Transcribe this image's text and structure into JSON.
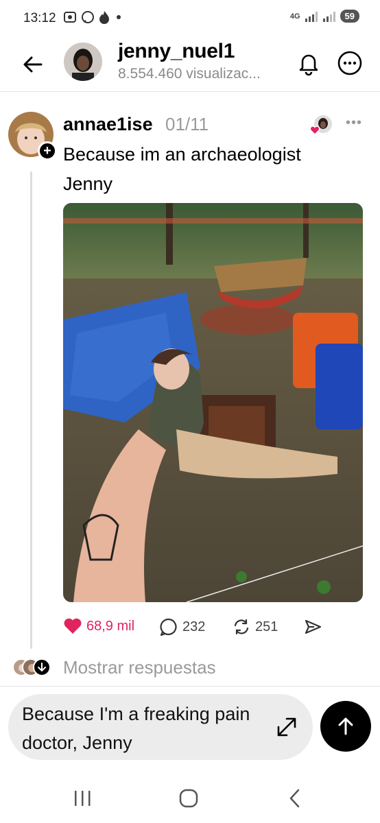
{
  "status_bar": {
    "time": "13:12",
    "network": "4G",
    "battery": "59"
  },
  "header": {
    "title": "jenny_nuel1",
    "subtitle": "8.554.460 visualizac..."
  },
  "post": {
    "username": "annae1ise",
    "date": "01/11",
    "text": "Because im an archaeologist Jenny",
    "image_description_icon": "photo",
    "likes": "68,9 mil",
    "comments": "232",
    "reposts": "251",
    "replies_label": "Mostrar respuestas"
  },
  "composer": {
    "text": "Because I'm a freaking pain doctor,  Jenny"
  },
  "colors": {
    "like": "#e0245e",
    "muted": "#9a9a9a",
    "composer_bg": "#ececec"
  }
}
